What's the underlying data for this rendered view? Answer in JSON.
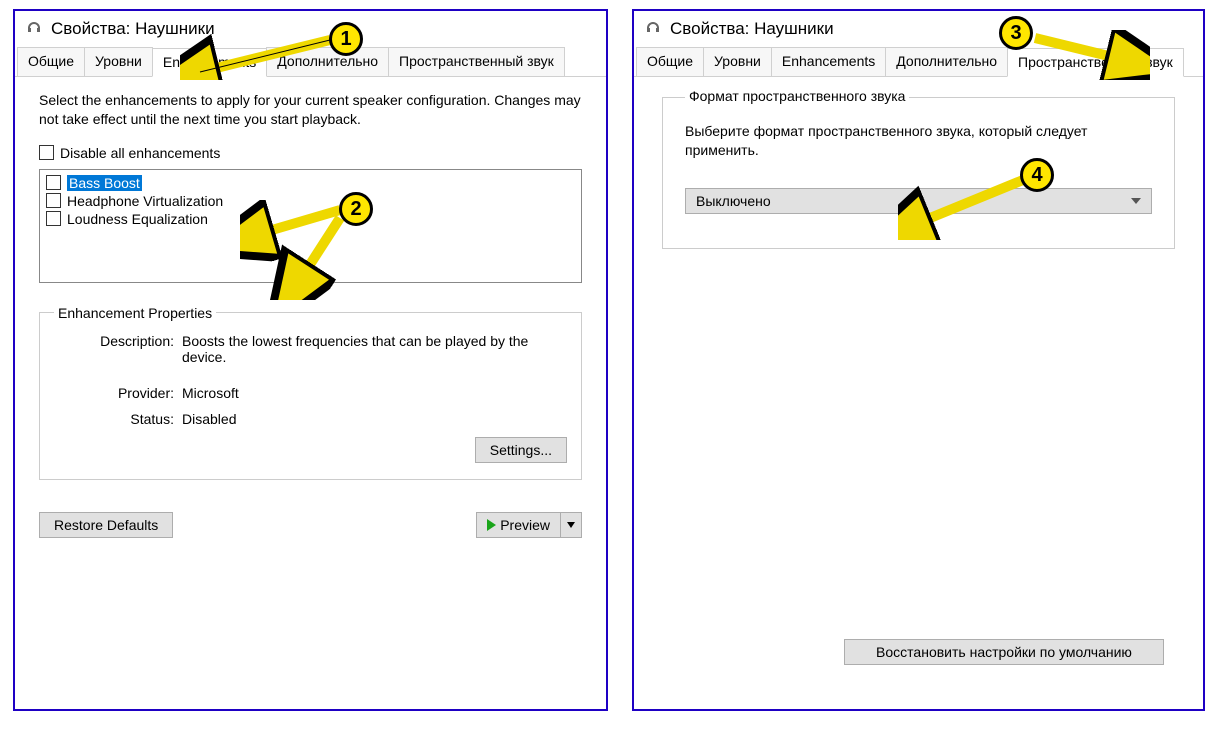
{
  "left": {
    "title": "Свойства: Наушники",
    "tabs": [
      "Общие",
      "Уровни",
      "Enhancements",
      "Дополнительно",
      "Пространственный звук"
    ],
    "active_tab": 2,
    "intro": "Select the enhancements to apply for your current speaker configuration. Changes may not take effect until the next time you start playback.",
    "disable_all": "Disable all enhancements",
    "enh_items": [
      "Bass Boost",
      "Headphone Virtualization",
      "Loudness Equalization"
    ],
    "group_legend": "Enhancement Properties",
    "props": {
      "desc_lbl": "Description:",
      "desc_val": "Boosts the lowest frequencies that can be played by the device.",
      "prov_lbl": "Provider:",
      "prov_val": "Microsoft",
      "stat_lbl": "Status:",
      "stat_val": "Disabled"
    },
    "settings_btn": "Settings...",
    "restore_btn": "Restore Defaults",
    "preview_btn": "Preview"
  },
  "right": {
    "title": "Свойства: Наушники",
    "tabs": [
      "Общие",
      "Уровни",
      "Enhancements",
      "Дополнительно",
      "Пространственный звук"
    ],
    "active_tab": 4,
    "group_legend": "Формат пространственного звука",
    "intro": "Выберите формат пространственного звука, который следует применить.",
    "combo_value": "Выключено",
    "restore_btn": "Восстановить настройки по умолчанию"
  },
  "callouts": {
    "c1": "1",
    "c2": "2",
    "c3": "3",
    "c4": "4"
  }
}
